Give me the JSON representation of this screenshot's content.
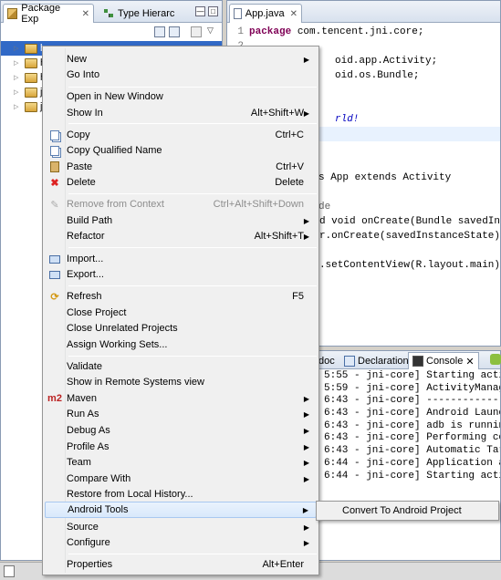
{
  "explorer": {
    "tabs": [
      {
        "label": "Package Exp"
      },
      {
        "label": "Type Hierarc"
      }
    ],
    "tree_rows": [
      {
        "label": "h"
      },
      {
        "label": "h"
      },
      {
        "label": "h"
      },
      {
        "label": "j"
      },
      {
        "label": "j"
      }
    ]
  },
  "editor": {
    "tab_label": "App.java",
    "lines": [
      {
        "num": "1",
        "kw": "package",
        "rest": " com.tencent.jni.core;"
      },
      {
        "num": "2",
        "kw": "",
        "rest": ""
      },
      {
        "num": "",
        "kw": "",
        "rest": "oid.app.Activity;"
      },
      {
        "num": "",
        "kw": "",
        "rest": "oid.os.Bundle;"
      },
      {
        "num": "",
        "kw": "",
        "rest": ""
      },
      {
        "num": "",
        "kw": "",
        "rest": ""
      },
      {
        "num": "",
        "kw": "",
        "rest": "rld!"
      },
      {
        "num": "",
        "kw": "",
        "rest": ""
      },
      {
        "num": "",
        "kw": "",
        "rest": ""
      },
      {
        "num": "",
        "kw": "",
        "rest": ""
      },
      {
        "num": "",
        "kw": "",
        "rest": "s App extends Activity"
      },
      {
        "num": "",
        "kw": "",
        "rest": ""
      },
      {
        "num": "",
        "kw": "",
        "rest": "de"
      },
      {
        "num": "",
        "kw": "",
        "rest": "ed void onCreate(Bundle savedIn"
      },
      {
        "num": "",
        "kw": "",
        "rest": "er.onCreate(savedInstanceState)"
      },
      {
        "num": "",
        "kw": "",
        "rest": ""
      },
      {
        "num": "",
        "kw": "",
        "rest": "s.setContentView(R.layout.main)"
      }
    ]
  },
  "console": {
    "tabs": [
      {
        "label": "doc"
      },
      {
        "label": "Declaration"
      },
      {
        "label": "Console"
      }
    ],
    "lines": [
      "5:55 - jni-core] Starting activ",
      "5:59 - jni-core] ActivityManage",
      "6:43 - jni-core] -------------",
      "6:43 - jni-core] Android Launch",
      "6:43 - jni-core] adb is running",
      "6:43 - jni-core] Performing com",
      "6:43 - jni-core] Automatic Targ",
      "6:44 - jni-core] Application al",
      "6:44 - jni-core] Starting activ"
    ]
  },
  "menu": {
    "new": {
      "label": "New"
    },
    "go_into": {
      "label": "Go Into"
    },
    "open_new_window": {
      "label": "Open in New Window"
    },
    "show_in": {
      "label": "Show In",
      "shortcut": "Alt+Shift+W"
    },
    "copy": {
      "label": "Copy",
      "shortcut": "Ctrl+C"
    },
    "copy_qualified": {
      "label": "Copy Qualified Name"
    },
    "paste": {
      "label": "Paste",
      "shortcut": "Ctrl+V"
    },
    "delete": {
      "label": "Delete",
      "shortcut": "Delete"
    },
    "remove_context": {
      "label": "Remove from Context",
      "shortcut": "Ctrl+Alt+Shift+Down"
    },
    "build_path": {
      "label": "Build Path"
    },
    "refactor": {
      "label": "Refactor",
      "shortcut": "Alt+Shift+T"
    },
    "import": {
      "label": "Import..."
    },
    "export": {
      "label": "Export..."
    },
    "refresh": {
      "label": "Refresh",
      "shortcut": "F5"
    },
    "close_project": {
      "label": "Close Project"
    },
    "close_unrelated": {
      "label": "Close Unrelated Projects"
    },
    "assign_working_sets": {
      "label": "Assign Working Sets..."
    },
    "validate": {
      "label": "Validate"
    },
    "show_remote": {
      "label": "Show in Remote Systems view"
    },
    "maven": {
      "label": "Maven",
      "icon_text": "m2"
    },
    "run_as": {
      "label": "Run As"
    },
    "debug_as": {
      "label": "Debug As"
    },
    "profile_as": {
      "label": "Profile As"
    },
    "team": {
      "label": "Team"
    },
    "compare_with": {
      "label": "Compare With"
    },
    "restore_history": {
      "label": "Restore from Local History..."
    },
    "android_tools": {
      "label": "Android Tools"
    },
    "source": {
      "label": "Source"
    },
    "configure": {
      "label": "Configure"
    },
    "properties": {
      "label": "Properties",
      "shortcut": "Alt+Enter"
    }
  },
  "submenu": {
    "convert": {
      "label": "Convert To Android Project"
    }
  }
}
